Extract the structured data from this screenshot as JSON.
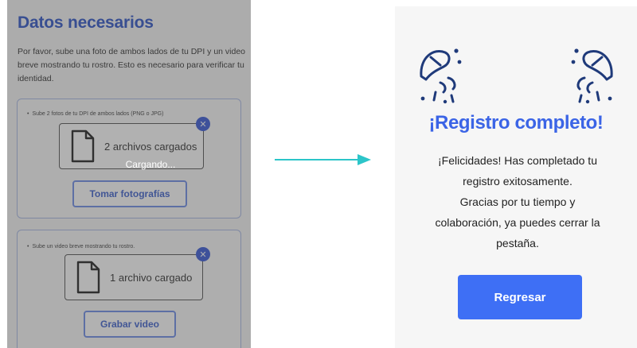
{
  "left_screen": {
    "title": "Datos necesarios",
    "intro": "Por favor, sube una foto de ambos lados de tu DPI y un video breve mostrando tu rostro. Esto es necesario para verificar tu identidad.",
    "dpi_section": {
      "instruction": "Sube 2 fotos de tu DPI de ambos lados (PNG o JPG)",
      "file_status": "2 archivos cargados",
      "button_label": "Tomar fotografías"
    },
    "video_section": {
      "instruction": "Sube un video breve mostrando tu rostro.",
      "file_status": "1 archivo cargado",
      "button_label": "Grabar video"
    },
    "loading_text": "Cargando..."
  },
  "right_screen": {
    "title": "¡Registro completo!",
    "message_lines": [
      "¡Felicidades! Has completado tu",
      "registro exitosamente.",
      "Gracias por tu tiempo y",
      "colaboración, ya puedes cerrar la",
      "pestaña."
    ],
    "button_label": "Regresar"
  },
  "icons": {
    "file": "file-icon",
    "remove": "close-icon",
    "arrow": "arrow-right-icon",
    "mascot": "confetti-mascot-icon"
  },
  "colors": {
    "brand_blue": "#3b64e6",
    "button_blue": "#3e6ff5",
    "arrow_teal": "#2cc5c9",
    "mascot_navy": "#1f3a7a"
  }
}
